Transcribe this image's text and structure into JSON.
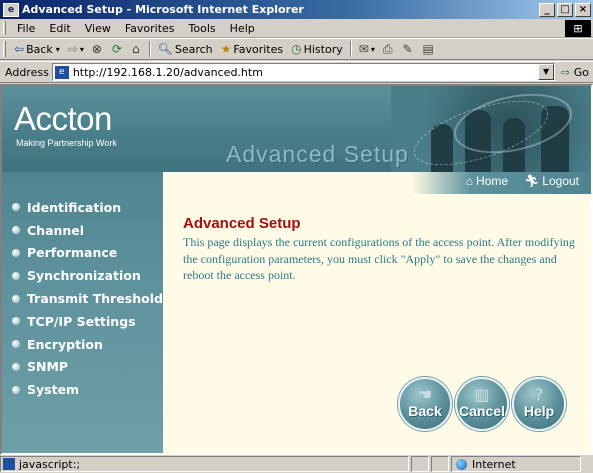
{
  "window": {
    "title": "Advanced Setup - Microsoft Internet Explorer",
    "controls": [
      "_",
      "□",
      "×"
    ]
  },
  "menubar": {
    "items": [
      "File",
      "Edit",
      "View",
      "Favorites",
      "Tools",
      "Help"
    ]
  },
  "toolbar": {
    "back_label": "Back",
    "search_label": "Search",
    "favorites_label": "Favorites",
    "history_label": "History"
  },
  "addressbar": {
    "label": "Address",
    "url": "http://192.168.1.20/advanced.htm",
    "go_label": "Go"
  },
  "banner": {
    "logo": "Accton",
    "tagline": "Making Partnership Work",
    "heading": "Advanced Setup"
  },
  "toplinks": {
    "home": "Home",
    "logout": "Logout"
  },
  "sidebar": {
    "items": [
      "Identification",
      "Channel",
      "Performance",
      "Synchronization",
      "Transmit Threshold",
      "TCP/IP Settings",
      "Encryption",
      "SNMP",
      "System"
    ]
  },
  "main": {
    "title": "Advanced Setup",
    "description": "This page displays the current configurations of the access point. After modifying the configuration parameters, you must click \"Apply\" to save the changes and reboot the access point."
  },
  "actions": {
    "back": "Back",
    "cancel": "Cancel",
    "help": "Help"
  },
  "statusbar": {
    "text": "javascript:;",
    "zone": "Internet"
  },
  "colors": {
    "banner": "#4a7f8a",
    "content_bg": "#fffbe6",
    "title_red": "#a01010",
    "text_teal": "#2b7a88"
  }
}
